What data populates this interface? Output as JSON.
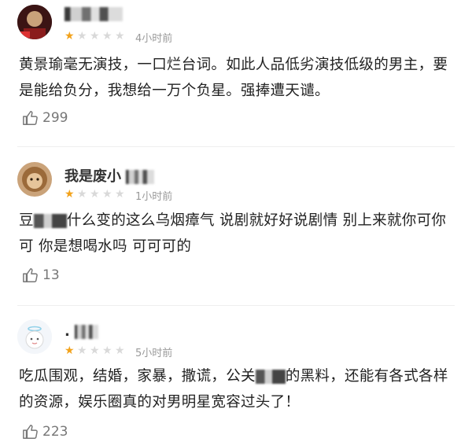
{
  "reviews": [
    {
      "username": "",
      "rating": 1,
      "time": "4小时前",
      "text": "黄景瑜毫无演技，一口烂台词。如此人品低劣演技低级的男主，要是能给负分，我想给一万个负星。强捧遭天谴。",
      "text_after_mask": "",
      "likes": "299"
    },
    {
      "username": "我是废小",
      "rating": 1,
      "time": "1小时前",
      "text_before_mask": "豆",
      "text": "什么变的这么乌烟瘴气 说剧就好好说剧情 别上来就你可你可 你是想喝水吗 可可可的",
      "likes": "13"
    },
    {
      "username": ".",
      "rating": 1,
      "time": "5小时前",
      "text_before_mask": "吃瓜围观，结婚，家暴，撒谎，公关",
      "text": "的黑料，还能有各式各样的资源，娱乐圈真的对男明星宽容过头了！",
      "likes": "223"
    }
  ],
  "colors": {
    "star_on": "#f2a21b",
    "star_off": "#d9d9d9",
    "meta": "#9a9a9a"
  },
  "icons": {
    "like": "thumbs-up-icon",
    "star": "star-icon"
  }
}
